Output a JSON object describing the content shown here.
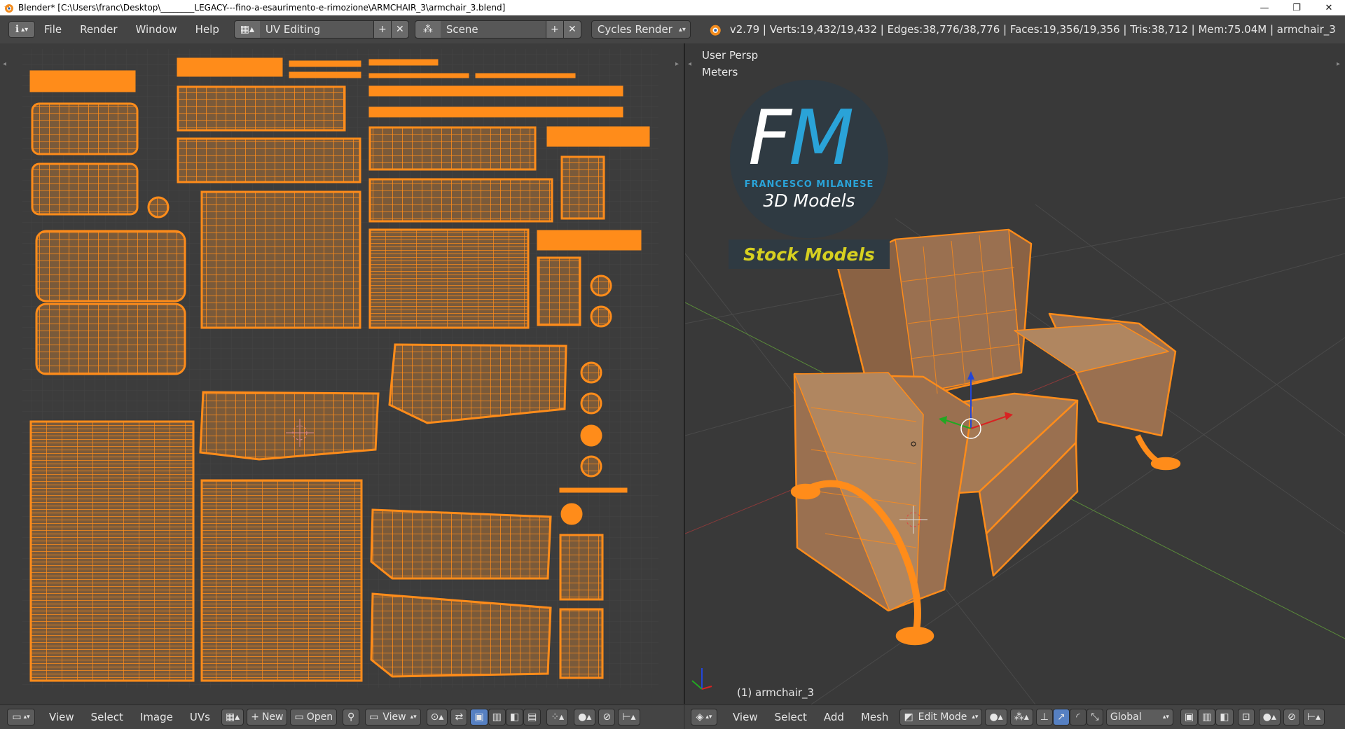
{
  "window": {
    "title": "Blender* [C:\\Users\\franc\\Desktop\\________LEGACY---fino-a-esaurimento-e-rimozione\\ARMCHAIR_3\\armchair_3.blend]",
    "controls": {
      "minimize": "—",
      "restore": "❐",
      "close": "✕"
    }
  },
  "info_header": {
    "editor_icon": "ℹ",
    "menus": [
      "File",
      "Render",
      "Window",
      "Help"
    ],
    "layout_field": "UV Editing",
    "scene_field": "Scene",
    "engine": "Cycles Render",
    "stats": "v2.79 | Verts:19,432/19,432 | Edges:38,776/38,776 | Faces:19,356/19,356 | Tris:38,712 | Mem:75.04M | armchair_3"
  },
  "uv_footer": {
    "menus": [
      "View",
      "Select",
      "Image",
      "UVs"
    ],
    "new_label": "New",
    "open_label": "Open",
    "view_label": "View"
  },
  "viewport": {
    "view_name": "User Persp",
    "units": "Meters",
    "object_label": "(1) armchair_3",
    "logo_letters": "FM",
    "logo_name": "FRANCESCO MILANESE",
    "logo_sub": "3D Models",
    "banner": "Stock Models"
  },
  "viewport_footer": {
    "menus": [
      "View",
      "Select",
      "Add",
      "Mesh"
    ],
    "mode": "Edit Mode",
    "orientation": "Global"
  },
  "colors": {
    "accent": "#ff8c1a",
    "panel": "#444444",
    "uv_bg": "#3c3c3c",
    "selected_fill": "#7a5a3a",
    "logo_blue": "#2aa3d8",
    "banner_yellow": "#d7d020"
  }
}
